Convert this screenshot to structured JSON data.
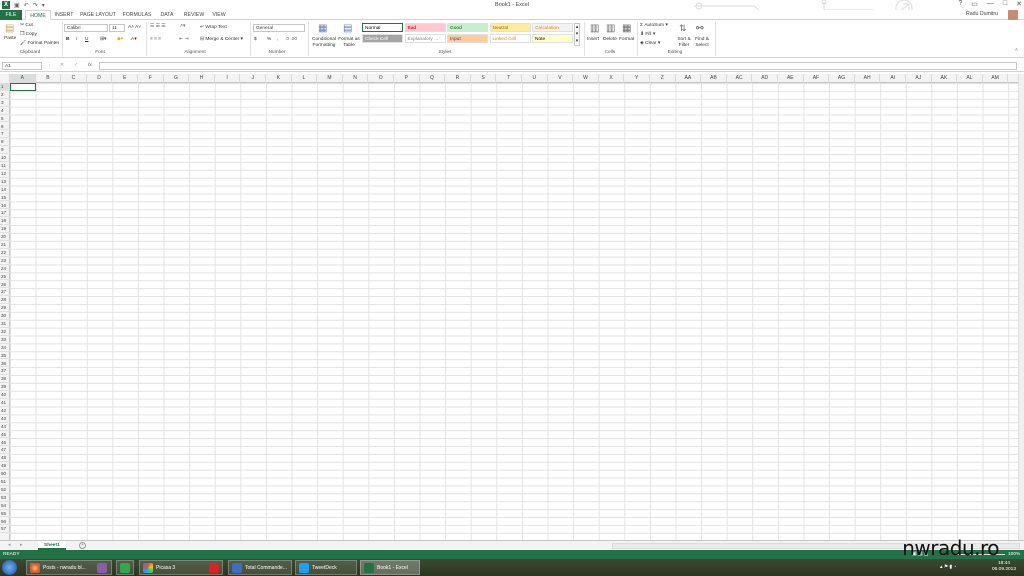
{
  "title_bar": {
    "app_icon": "X",
    "title": "Book1 - Excel",
    "controls": [
      "?",
      "▭",
      "—",
      "□",
      "✕"
    ]
  },
  "tabs": [
    {
      "label": "FILE"
    },
    {
      "label": "HOME"
    },
    {
      "label": "INSERT"
    },
    {
      "label": "PAGE LAYOUT"
    },
    {
      "label": "FORMULAS"
    },
    {
      "label": "DATA"
    },
    {
      "label": "REVIEW"
    },
    {
      "label": "VIEW"
    }
  ],
  "user": {
    "name": "Radu Dumitru"
  },
  "ribbon": {
    "clipboard": {
      "paste": "Paste",
      "cut": "Cut",
      "copy": "Copy",
      "format_painter": "Format Painter",
      "label": "Clipboard"
    },
    "font": {
      "name": "Calibri",
      "size": "11",
      "bold": "B",
      "italic": "I",
      "underline": "U",
      "label": "Font"
    },
    "alignment": {
      "wrap_text": "Wrap Text",
      "merge_center": "Merge & Center",
      "label": "Alignment"
    },
    "number": {
      "format": "General",
      "currency": "$",
      "percent": "%",
      "comma": ",",
      "label": "Number"
    },
    "styles": {
      "conditional": "Conditional Formatting",
      "format_table": "Format as Table",
      "cells": [
        {
          "name": "Normal",
          "bg": "#ffffff",
          "fg": "#000000"
        },
        {
          "name": "Bad",
          "bg": "#ffc7ce",
          "fg": "#9c0006"
        },
        {
          "name": "Good",
          "bg": "#c6efce",
          "fg": "#006100"
        },
        {
          "name": "Neutral",
          "bg": "#ffeb9c",
          "fg": "#9c6500"
        },
        {
          "name": "Calculation",
          "bg": "#f2f2f2",
          "fg": "#fa7d00"
        },
        {
          "name": "Check Cell",
          "bg": "#a5a5a5",
          "fg": "#ffffff"
        },
        {
          "name": "Explanatory ...",
          "bg": "#ffffff",
          "fg": "#7f7f7f"
        },
        {
          "name": "Input",
          "bg": "#ffcc99",
          "fg": "#3f3f76"
        },
        {
          "name": "Linked Cell",
          "bg": "#ffffff",
          "fg": "#fa7d00"
        },
        {
          "name": "Note",
          "bg": "#ffffcc",
          "fg": "#000000"
        }
      ],
      "label": "Styles"
    },
    "cells": {
      "insert": "Insert",
      "delete": "Delete",
      "format": "Format",
      "label": "Cells"
    },
    "editing": {
      "autosum": "AutoSum",
      "fill": "Fill",
      "clear": "Clear",
      "sort_filter": "Sort & Filter",
      "find_select": "Find & Select",
      "label": "Editing"
    }
  },
  "formula_bar": {
    "name_box": "A1",
    "fx": "fx",
    "value": ""
  },
  "columns": [
    "A",
    "B",
    "C",
    "D",
    "E",
    "F",
    "G",
    "H",
    "I",
    "J",
    "K",
    "L",
    "M",
    "N",
    "O",
    "P",
    "Q",
    "R",
    "S",
    "T",
    "U",
    "V",
    "W",
    "X",
    "Y",
    "Z",
    "AA",
    "AB",
    "AC",
    "AD",
    "AE",
    "AF",
    "AG",
    "AH",
    "AI",
    "AJ",
    "AK",
    "AL",
    "AM"
  ],
  "row_count": 57,
  "sheet": {
    "name": "Sheet1"
  },
  "status": {
    "text": "READY",
    "zoom": "100%"
  },
  "taskbar": {
    "items": [
      {
        "label": "Posts - nwradu bl..."
      },
      {
        "label": "Picasa 3"
      },
      {
        "label": "Total Commande..."
      },
      {
        "label": "TweetDeck"
      },
      {
        "label": "Book1 - Excel"
      }
    ],
    "time": "18:44",
    "date": "06.09.2013"
  },
  "watermark": "nwradu.ro"
}
